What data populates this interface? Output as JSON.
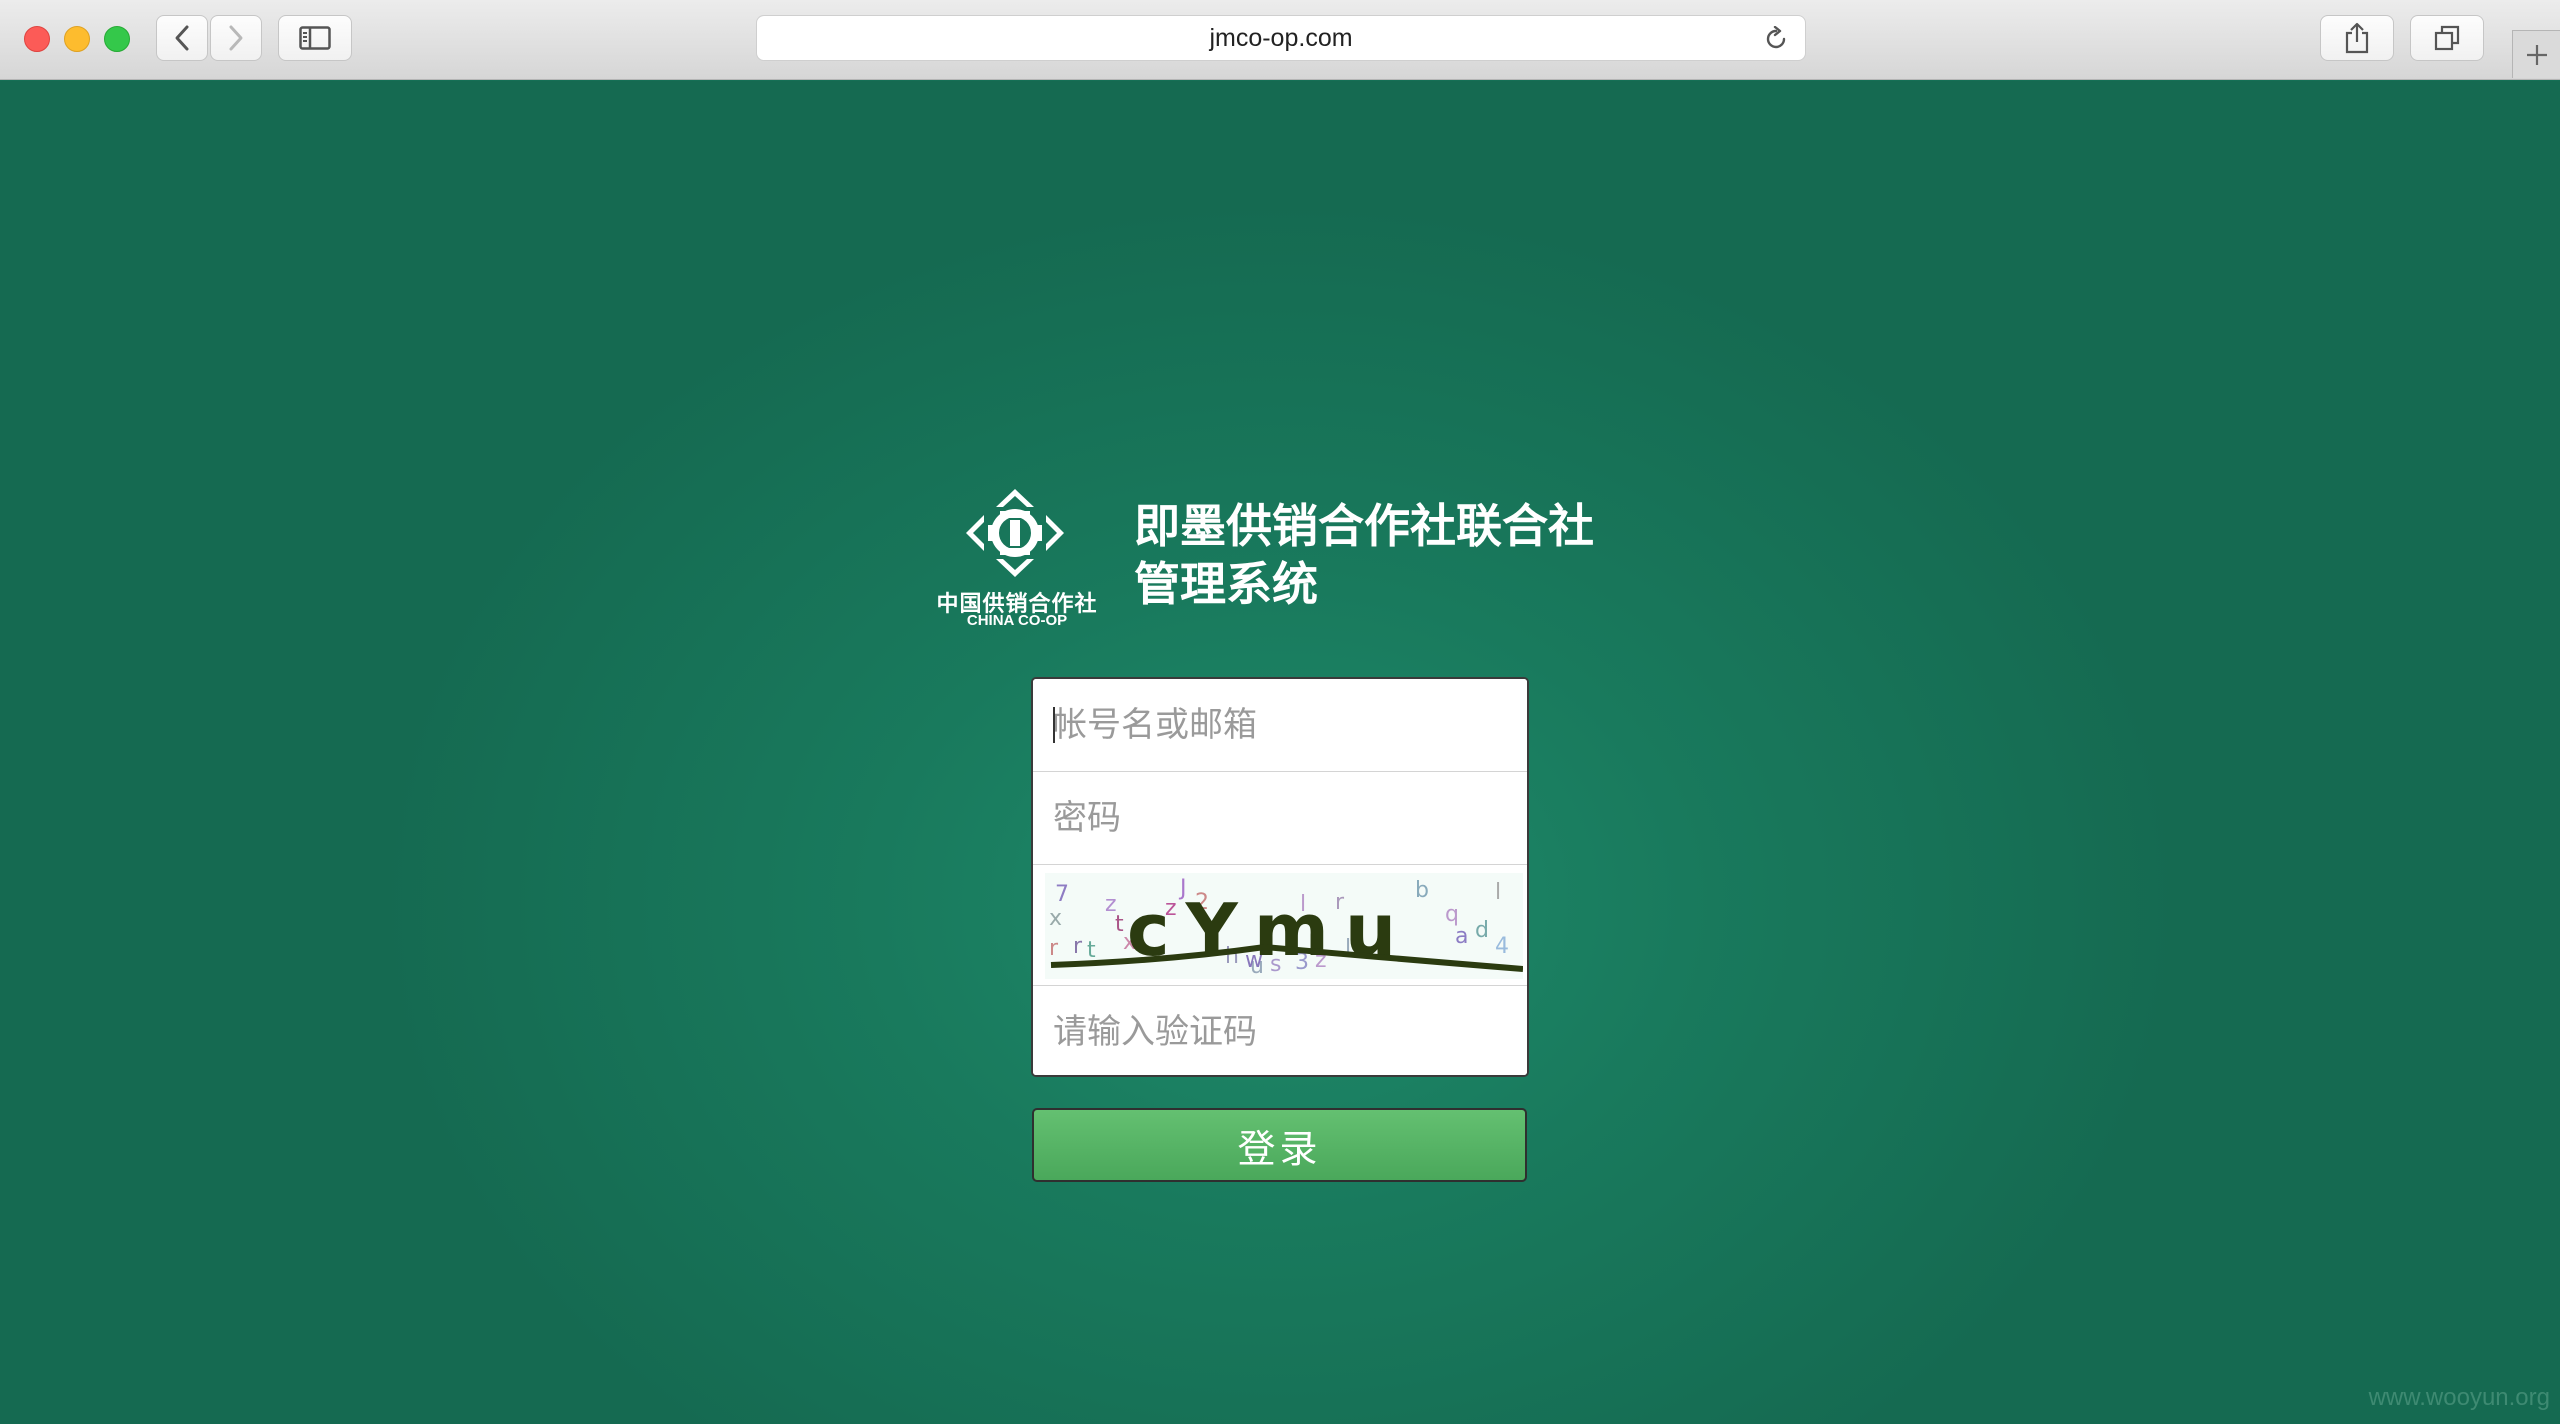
{
  "browser": {
    "url": "jmco-op.com",
    "icons": {
      "back": "chevron-left-icon",
      "forward": "chevron-right-icon",
      "sidebar": "sidebar-icon",
      "reload": "reload-icon",
      "share": "share-icon",
      "tabs": "tabs-overview-icon",
      "new_tab": "plus-icon"
    }
  },
  "logo": {
    "cn_text": "中国供销合作社",
    "en_text": "CHINA CO-OP"
  },
  "header": {
    "title_line1": "即墨供销合作社联合社",
    "title_line2": "管理系统"
  },
  "form": {
    "username_placeholder": "帐号名或邮箱",
    "password_placeholder": "密码",
    "captcha_text": "cYmu",
    "captcha_placeholder": "请输入验证码",
    "login_label": "登录"
  },
  "watermark": "www.wooyun.org",
  "colors": {
    "background": "#1a7a5e",
    "login_button": "#56b365",
    "logo_text": "#ffffff"
  }
}
